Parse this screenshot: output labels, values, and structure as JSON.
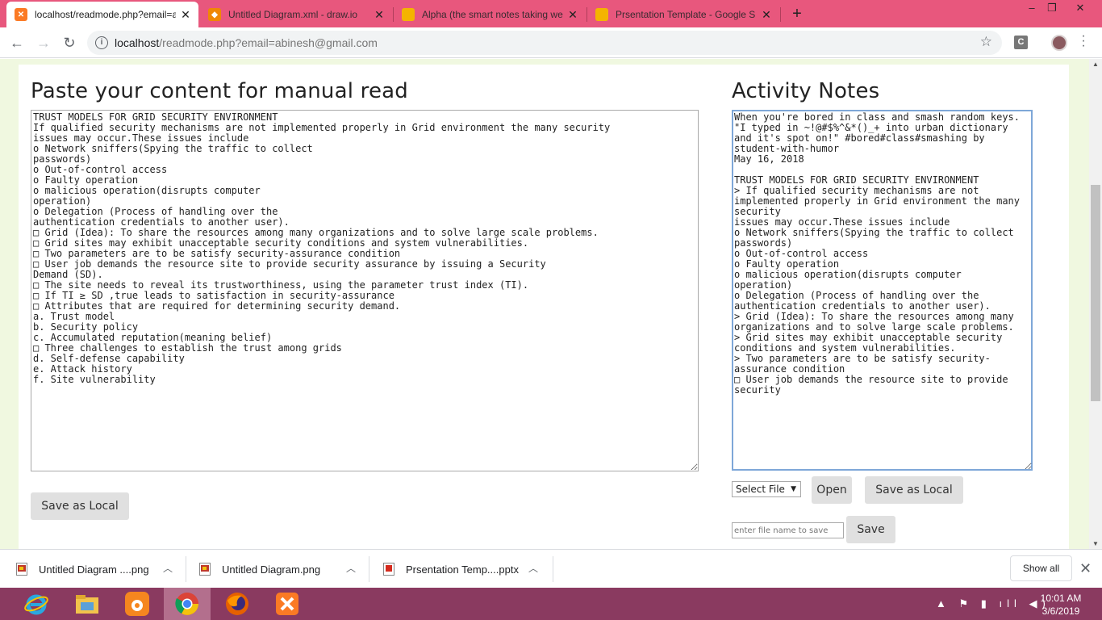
{
  "browser": {
    "tabs": [
      {
        "title": "localhost/readmode.php?email=a",
        "icon": "xampp-icon",
        "color": "#fb7a24",
        "active": true
      },
      {
        "title": "Untitled Diagram.xml - draw.io",
        "icon": "drawio-icon",
        "color": "#f08705",
        "active": false
      },
      {
        "title": "Alpha (the smart notes taking we",
        "icon": "slides-icon",
        "color": "#f4b400",
        "active": false
      },
      {
        "title": "Prsentation Template - Google S",
        "icon": "slides-icon",
        "color": "#f4b400",
        "active": false
      }
    ],
    "window_controls": {
      "minimize": "–",
      "restore": "❐",
      "close": "✕"
    },
    "address": {
      "host": "localhost",
      "path": "/readmode.php?email=abinesh@gmail.com"
    },
    "extension_label": "C"
  },
  "page": {
    "left_heading": "Paste your content for manual read",
    "main_text": "TRUST MODELS FOR GRID SECURITY ENVIRONMENT\nIf qualified security mechanisms are not implemented properly in Grid environment the many security\nissues may occur.These issues include\no Network sniffers(Spying the traffic to collect\npasswords)\no Out-of-control access\no Faulty operation\no malicious operation(disrupts computer\noperation)\no Delegation (Process of handling over the\nauthentication credentials to another user).\n□ Grid (Idea): To share the resources among many organizations and to solve large scale problems.\n□ Grid sites may exhibit unacceptable security conditions and system vulnerabilities.\n□ Two parameters are to be satisfy security-assurance condition\n□ User job demands the resource site to provide security assurance by issuing a Security\nDemand (SD).\n□ The site needs to reveal its trustworthiness, using the parameter trust index (TI).\n□ If TI ≥ SD ,true leads to satisfaction in security-assurance\n□ Attributes that are required for determining security demand.\na. Trust model\nb. Security policy\nc. Accumulated reputation(meaning belief)\n□ Three challenges to establish the trust among grids\nd. Self-defense capability\ne. Attack history\nf. Site vulnerability",
    "left_save_label": "Save as Local",
    "right_heading": "Activity Notes",
    "notes_text": "When you're bored in class and smash random keys. \"I typed in ~!@#$%^&*()_+ into urban dictionary and it's spot on!\" #bored#class#smashing by student-with-humor\nMay 16, 2018\n\nTRUST MODELS FOR GRID SECURITY ENVIRONMENT\n> If qualified security mechanisms are not implemented properly in Grid environment the many security\nissues may occur.These issues include\no Network sniffers(Spying the traffic to collect\npasswords)\no Out-of-control access\no Faulty operation\no malicious operation(disrupts computer\noperation)\no Delegation (Process of handling over the\nauthentication credentials to another user).\n> Grid (Idea): To share the resources among many organizations and to solve large scale problems.\n> Grid sites may exhibit unacceptable security conditions and system vulnerabilities.\n> Two parameters are to be satisfy security-assurance condition\n□ User job demands the resource site to provide security",
    "select_file_label": "Select File",
    "open_label": "Open",
    "right_save_local_label": "Save as Local",
    "filename_placeholder": "enter file name to save",
    "save_label": "Save"
  },
  "downloads": {
    "items": [
      {
        "name": "Untitled Diagram ....png"
      },
      {
        "name": "Untitled Diagram.png"
      },
      {
        "name": "Prsentation Temp....pptx"
      }
    ],
    "show_all_label": "Show all"
  },
  "taskbar": {
    "apps": [
      "internet-explorer-icon",
      "file-explorer-icon",
      "uc-browser-icon",
      "chrome-icon",
      "firefox-icon",
      "xampp-icon"
    ],
    "time": "10:01 AM",
    "date": "3/6/2019"
  }
}
